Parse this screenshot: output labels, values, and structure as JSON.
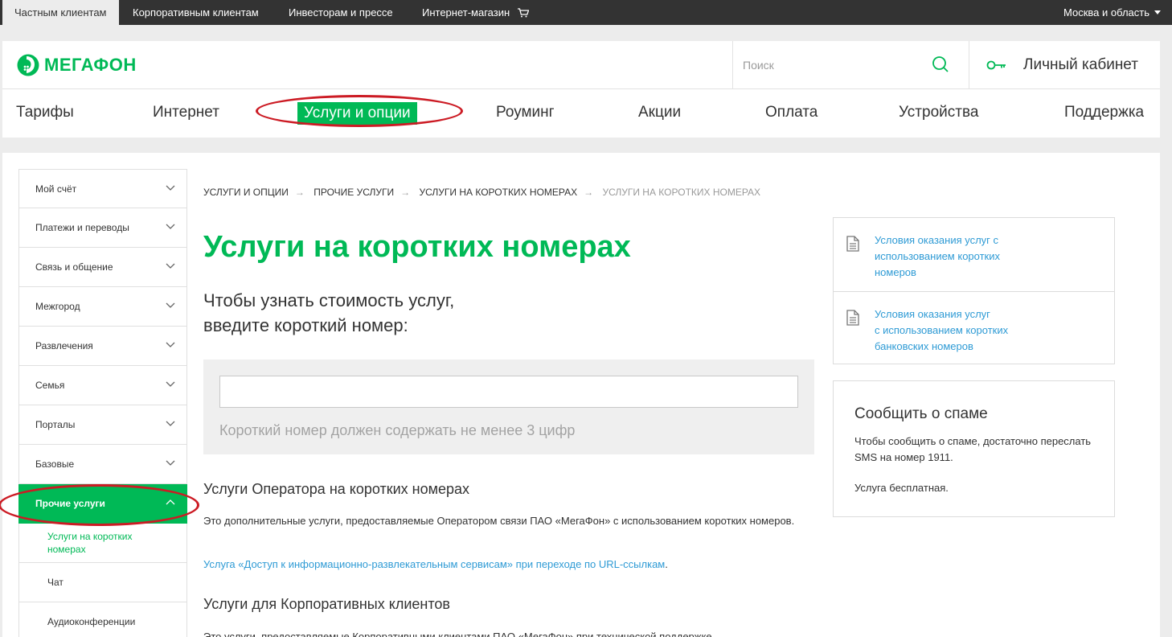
{
  "topbar": {
    "segments": [
      "Частным клиентам",
      "Корпоративным клиентам",
      "Инвесторам и прессе",
      "Интернет-магазин"
    ],
    "region": "Москва и область"
  },
  "header": {
    "logo": "МЕГАФОН",
    "search_placeholder": "Поиск",
    "cabinet_label": "Личный кабинет"
  },
  "nav": [
    "Тарифы",
    "Интернет",
    "Услуги и опции",
    "Роуминг",
    "Акции",
    "Оплата",
    "Устройства",
    "Поддержка"
  ],
  "sidebar": {
    "items": [
      "Мой счёт",
      "Платежи и переводы",
      "Связь и общение",
      "Межгород",
      "Развлечения",
      "Семья",
      "Порталы",
      "Базовые",
      "Прочие услуги"
    ],
    "subitems": [
      "Услуги на коротких номерах",
      "Чат",
      "Аудиоконференции"
    ]
  },
  "breadcrumb": [
    "УСЛУГИ И ОПЦИИ",
    "ПРОЧИЕ УСЛУГИ",
    "УСЛУГИ НА КОРОТКИХ НОМЕРАХ",
    "УСЛУГИ НА КОРОТКИХ НОМЕРАХ"
  ],
  "main": {
    "title": "Услуги на коротких номерах",
    "lead_line1": "Чтобы узнать стоимость услуг,",
    "lead_line2": "введите короткий номер:",
    "input_value": "",
    "hint": "Короткий номер должен содержать не менее 3 цифр",
    "section1_title": "Услуги Оператора на коротких номерах",
    "section1_text": "Это дополнительные услуги, предоставляемые Оператором связи ПАО «МегаФон» с использованием коротких номеров.",
    "section1_link": "Услуга «Доступ к информационно-развлекательным сервисам» при переходе по URL-ссылкам",
    "section1_link_tail": ".",
    "section2_title": "Услуги для Корпоративных клиентов",
    "section2_text": "Это услуги, предоставляемые Корпоративными клиентами ПАО «МегаФон» при технической поддержке"
  },
  "docs": [
    {
      "line1": "Условия оказания услуг с",
      "line2": "использованием коротких",
      "line3": "номеров"
    },
    {
      "line1": "Условия оказания услуг",
      "line2": "с использованием коротких",
      "line3": "банковских номеров"
    }
  ],
  "spam": {
    "title": "Сообщить о спаме",
    "text": "Чтобы сообщить о спаме, достаточно переслать SMS на номер 1911.",
    "free": "Услуга бесплатная."
  },
  "colors": {
    "brand": "#00b956",
    "link": "#2f9bd5",
    "annotation": "#cc1b24",
    "topbar": "#333333"
  }
}
